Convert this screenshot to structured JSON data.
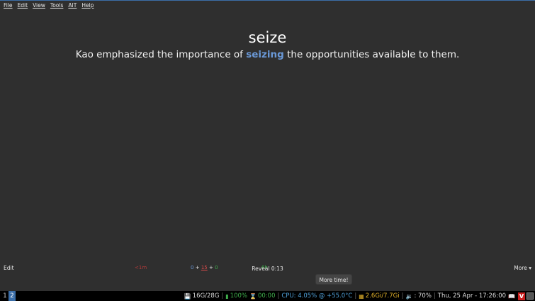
{
  "menu": {
    "items": [
      "File",
      "Edit",
      "View",
      "Tools",
      "AIT",
      "Help"
    ]
  },
  "card": {
    "word": "seize",
    "sentence_before": "Kao emphasized the importance of ",
    "sentence_highlight": "seizing",
    "sentence_after": " the opportunities available to them."
  },
  "reviewbar": {
    "edit_label": "Edit",
    "more_label": "More ▾",
    "again_time": "<1m",
    "count_new": "0",
    "count_plus1": "+",
    "count_learn": "15",
    "count_plus2": "+",
    "count_review": "0",
    "good_time": "6h",
    "reveal_label": "Reveal 0:13",
    "more_time_label": "More time!"
  },
  "taskbar": {
    "workspaces": [
      "1",
      "2"
    ],
    "active_workspace": "2",
    "disk": "16G/28G",
    "battery": "100%",
    "timer": "00:00",
    "cpu": "CPU:  4.05% @ +55.0°C",
    "memory": "2.6Gi/7.7Gi",
    "volume": ": 70%",
    "datetime": "Thu, 25 Apr - 17:26:00"
  },
  "icons": {
    "disk": "floppy-disk-icon",
    "battery": "battery-icon",
    "timer": "hourglass-icon",
    "memory": "memory-icon",
    "volume": "speaker-icon",
    "book": "book-icon",
    "vivaldi": "vivaldi-icon",
    "tray_app": "tray-app-icon"
  },
  "colors": {
    "highlight": "#6a99d8",
    "workspace_active": "#3b6ea8",
    "new": "#6a99d8",
    "learn": "#d84a4a",
    "review": "#3fae4c",
    "cpu": "#4fa0d8",
    "memory": "#e0b02a"
  }
}
